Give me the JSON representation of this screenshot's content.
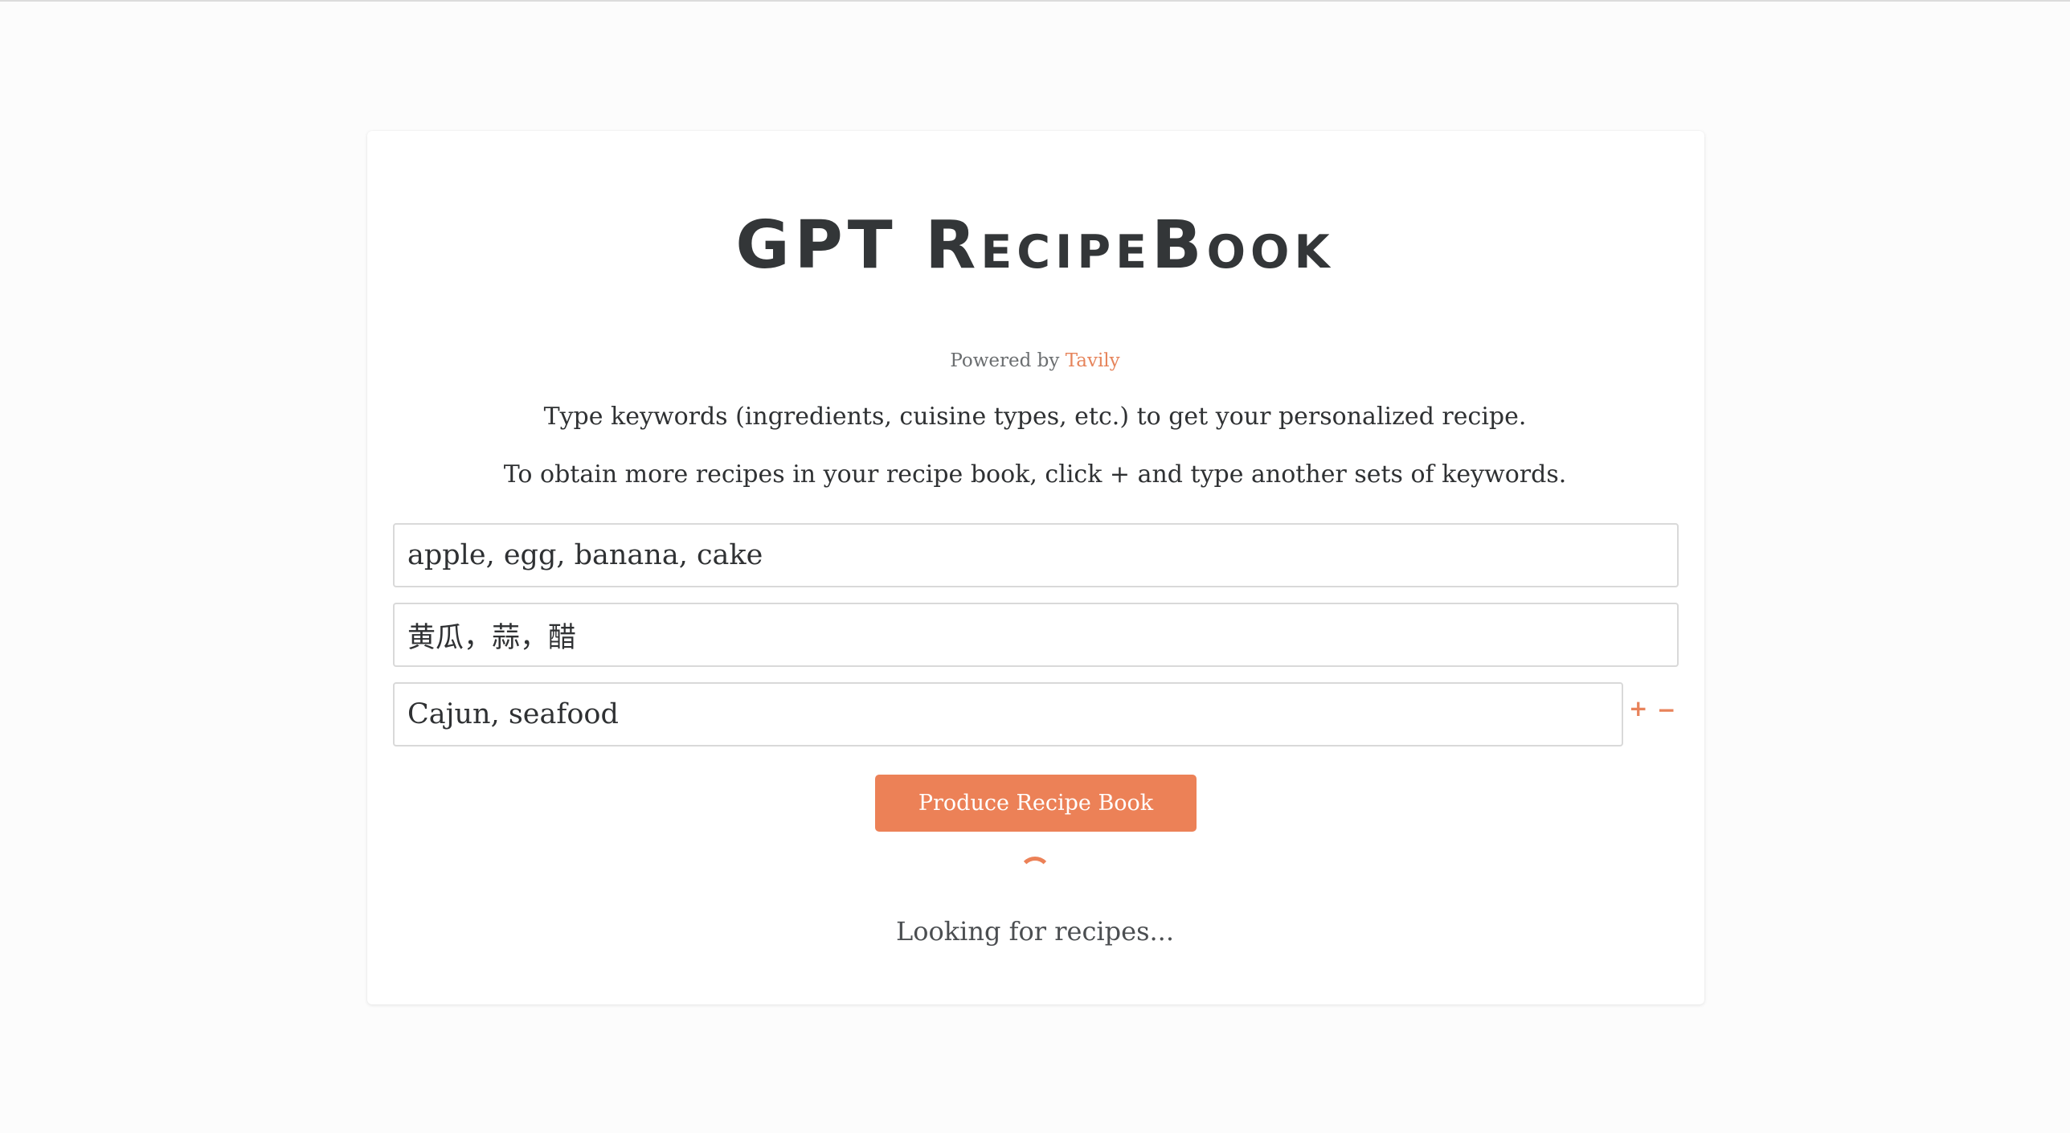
{
  "header": {
    "title": "GPT RecipeBook",
    "powered_prefix": "Powered by",
    "powered_brand": "Tavily"
  },
  "instructions": {
    "line1": "Type keywords (ingredients, cuisine types, etc.) to get your personalized recipe.",
    "line2": "To obtain more recipes in your recipe book, click + and type another sets of keywords."
  },
  "keyword_inputs": [
    {
      "value": "apple, egg, banana, cake"
    },
    {
      "value": "黄瓜，蒜，醋"
    },
    {
      "value": "Cajun, seafood"
    }
  ],
  "controls": {
    "add_label": "+",
    "remove_label": "−"
  },
  "actions": {
    "produce_label": "Produce Recipe Book"
  },
  "status": {
    "loading_text": "Looking for recipes..."
  },
  "colors": {
    "accent": "#ec8157",
    "title": "#333638",
    "background": "#fcfcfc"
  }
}
